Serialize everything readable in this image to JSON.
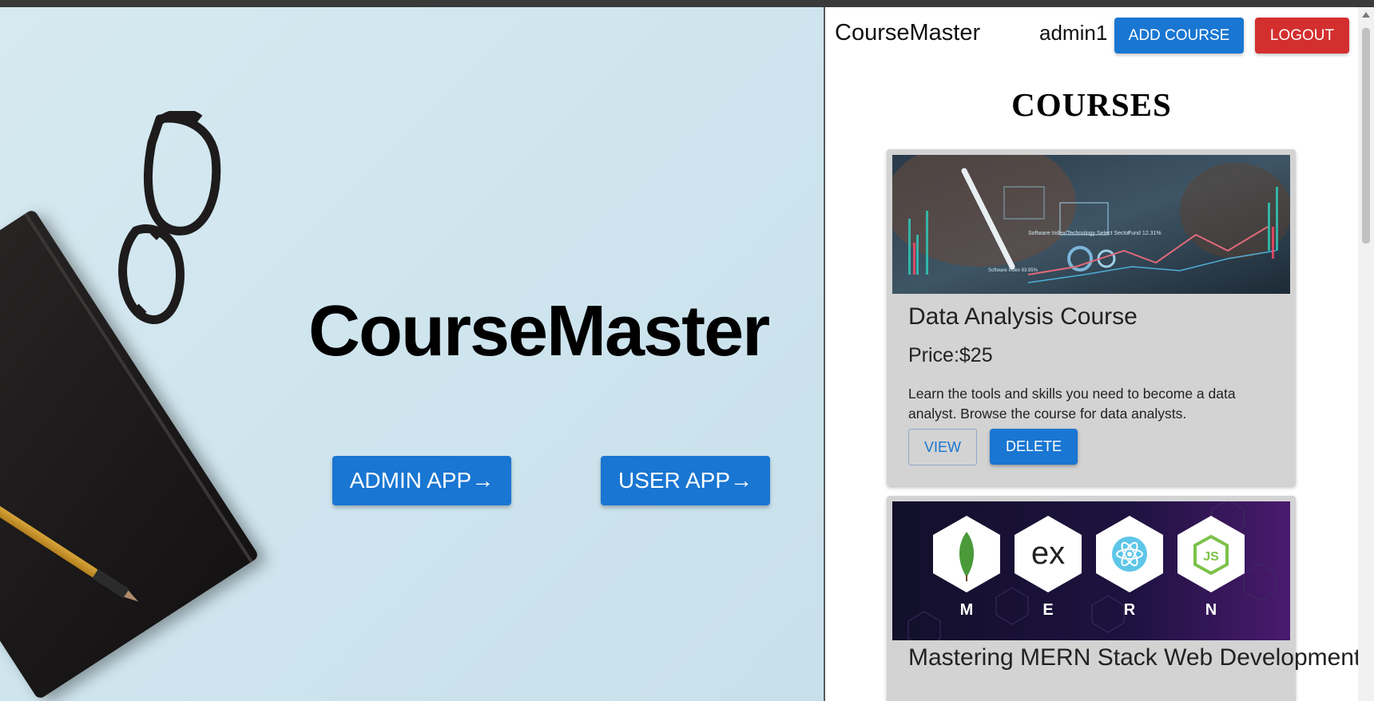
{
  "landing": {
    "brand": "CourseMaster",
    "admin_button": "ADMIN APP→",
    "user_button": "USER APP→"
  },
  "appbar": {
    "title": "CourseMaster",
    "username": "admin1",
    "add_course": "ADD COURSE",
    "logout": "LOGOUT"
  },
  "page": {
    "heading": "COURSES"
  },
  "courses": [
    {
      "title": "Data Analysis Course",
      "price": "Price:$25",
      "description": "Learn the tools and skills you need to become a data analyst. Browse the course for data analysts.",
      "view": "VIEW",
      "delete": "DELETE",
      "image_text": [
        "Software Index/Technology Select Sector",
        "Fund 12.31%",
        "Software Index 63.95%"
      ]
    },
    {
      "title": "Mastering MERN Stack Web Development",
      "image_letters": [
        "M",
        "E",
        "R",
        "N"
      ],
      "image_logo_text": "ex"
    }
  ],
  "colors": {
    "primary": "#1976d2",
    "danger": "#d32f2f",
    "card": "#d3d3d3",
    "landing_bg": "#d6e9f0"
  }
}
